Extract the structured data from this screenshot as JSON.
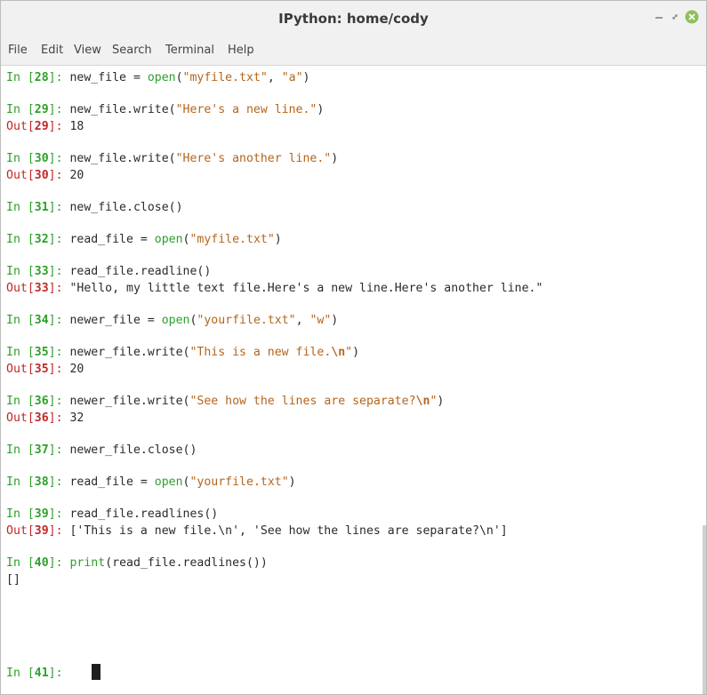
{
  "window": {
    "title": "IPython: home/cody",
    "controls": {
      "minimize": "–",
      "restore": "⤢",
      "close": "×"
    }
  },
  "menu": [
    "File",
    "Edit",
    "View",
    "Search",
    "Terminal",
    "Help"
  ],
  "colors": {
    "prompt_in": "#2e9f2a",
    "prompt_out": "#c12828",
    "string": "#b5651d",
    "background": "#ffffff",
    "cursor": "#1e1e1e"
  },
  "terminal": {
    "lines": [
      {
        "kind": "in",
        "n": "28",
        "code": [
          {
            "t": "new_file = "
          },
          {
            "t": "open",
            "c": "gr"
          },
          {
            "t": "("
          },
          {
            "t": "\"myfile.txt\"",
            "c": "st"
          },
          {
            "t": ", "
          },
          {
            "t": "\"a\"",
            "c": "st"
          },
          {
            "t": ")"
          }
        ]
      },
      {
        "kind": "in",
        "n": "29",
        "code": [
          {
            "t": "new_file.write("
          },
          {
            "t": "\"Here's a new line.\"",
            "c": "st"
          },
          {
            "t": ")"
          }
        ]
      },
      {
        "kind": "out",
        "n": "29",
        "text": "18"
      },
      {
        "kind": "in",
        "n": "30",
        "code": [
          {
            "t": "new_file.write("
          },
          {
            "t": "\"Here's another line.\"",
            "c": "st"
          },
          {
            "t": ")"
          }
        ]
      },
      {
        "kind": "out",
        "n": "30",
        "text": "20"
      },
      {
        "kind": "in",
        "n": "31",
        "code": [
          {
            "t": "new_file.close()"
          }
        ]
      },
      {
        "kind": "in",
        "n": "32",
        "code": [
          {
            "t": "read_file = "
          },
          {
            "t": "open",
            "c": "gr"
          },
          {
            "t": "("
          },
          {
            "t": "\"myfile.txt\"",
            "c": "st"
          },
          {
            "t": ")"
          }
        ]
      },
      {
        "kind": "in",
        "n": "33",
        "code": [
          {
            "t": "read_file.readline()"
          }
        ]
      },
      {
        "kind": "out",
        "n": "33",
        "text": "\"Hello, my little text file.Here's a new line.Here's another line.\""
      },
      {
        "kind": "in",
        "n": "34",
        "code": [
          {
            "t": "newer_file = "
          },
          {
            "t": "open",
            "c": "gr"
          },
          {
            "t": "("
          },
          {
            "t": "\"yourfile.txt\"",
            "c": "st"
          },
          {
            "t": ", "
          },
          {
            "t": "\"w\"",
            "c": "st"
          },
          {
            "t": ")"
          }
        ]
      },
      {
        "kind": "in",
        "n": "35",
        "code": [
          {
            "t": "newer_file.write("
          },
          {
            "t": "\"This is a new file.",
            "c": "st"
          },
          {
            "t": "\\n",
            "c": "esc"
          },
          {
            "t": "\"",
            "c": "st"
          },
          {
            "t": ")"
          }
        ]
      },
      {
        "kind": "out",
        "n": "35",
        "text": "20"
      },
      {
        "kind": "in",
        "n": "36",
        "code": [
          {
            "t": "newer_file.write("
          },
          {
            "t": "\"See how the lines are separate?",
            "c": "st"
          },
          {
            "t": "\\n",
            "c": "esc"
          },
          {
            "t": "\"",
            "c": "st"
          },
          {
            "t": ")"
          }
        ]
      },
      {
        "kind": "out",
        "n": "36",
        "text": "32"
      },
      {
        "kind": "in",
        "n": "37",
        "code": [
          {
            "t": "newer_file.close()"
          }
        ]
      },
      {
        "kind": "in",
        "n": "38",
        "code": [
          {
            "t": "read_file = "
          },
          {
            "t": "open",
            "c": "gr"
          },
          {
            "t": "("
          },
          {
            "t": "\"yourfile.txt\"",
            "c": "st"
          },
          {
            "t": ")"
          }
        ]
      },
      {
        "kind": "in",
        "n": "39",
        "code": [
          {
            "t": "read_file.readlines()"
          }
        ]
      },
      {
        "kind": "out",
        "n": "39",
        "text": "['This is a new file.\\n', 'See how the lines are separate?\\n']"
      },
      {
        "kind": "in",
        "n": "40",
        "code": [
          {
            "t": "print",
            "c": "gr"
          },
          {
            "t": "(read_file.readlines())"
          }
        ]
      },
      {
        "kind": "text",
        "text": "[]"
      },
      {
        "kind": "in",
        "n": "41",
        "code": []
      }
    ]
  }
}
